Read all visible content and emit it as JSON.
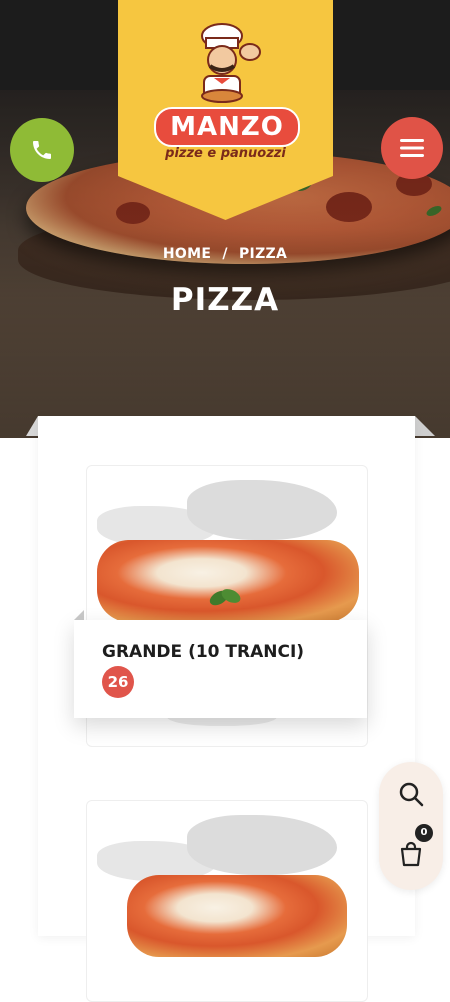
{
  "brand": {
    "name": "MANZO",
    "tagline": "pizze e panuozzi"
  },
  "breadcrumb": {
    "home": "HOME",
    "separator": "/",
    "current": "PIZZA"
  },
  "page": {
    "title": "PIZZA"
  },
  "products": [
    {
      "name": "GRANDE (10 TRANCI)",
      "price": "26"
    }
  ],
  "cart": {
    "count": "0"
  },
  "icons": {
    "phone": "phone-icon",
    "menu": "hamburger-icon",
    "search": "search-icon",
    "cart": "cart-icon"
  },
  "colors": {
    "accent_yellow": "#f6c640",
    "phone_green": "#8fbb36",
    "menu_red": "#e05347",
    "price_red": "#e0554b",
    "brand_red": "#e84c3d"
  }
}
